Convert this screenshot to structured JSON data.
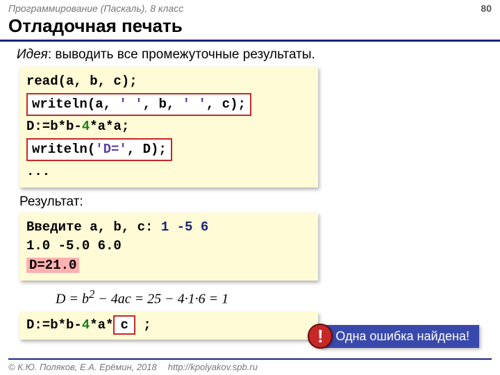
{
  "header": {
    "course": "Программирование (Паскаль), 8 класс",
    "page": "80"
  },
  "title": "Отладочная печать",
  "idea_label": "Идея",
  "idea_text": ": выводить все промежуточные результаты.",
  "code1": {
    "l1": "read(a, b, c);",
    "l2_pre": "writeln(a, ",
    "l2_s1": "' '",
    "l2_mid1": ", b, ",
    "l2_s2": "' '",
    "l2_mid2": ", c);",
    "l3_a": "D:=b*b-",
    "l3_4": "4",
    "l3_b": "*a*a;",
    "l4_pre": "writeln(",
    "l4_str": "'D='",
    "l4_post": ", D);",
    "l5": "..."
  },
  "result_label": "Результат:",
  "output": {
    "p1": "Введите a, b, c: ",
    "inp": "1 -5 6",
    "line2": "1.0 -5.0 6.0",
    "dline": "D=21.0"
  },
  "formula": "D = b² − 4ac = 25 − 4·1·6 = 1",
  "fix": {
    "a": "D:=b*b-",
    "four": "4",
    "b": "*a*",
    "c": "c",
    "tail": " ;"
  },
  "callout": {
    "bang": "!",
    "text": "Одна ошибка найдена!"
  },
  "footer": {
    "copy": "© К.Ю. Поляков, Е.А. Ерёмин, 2018",
    "url": "http://kpolyakov.spb.ru"
  }
}
